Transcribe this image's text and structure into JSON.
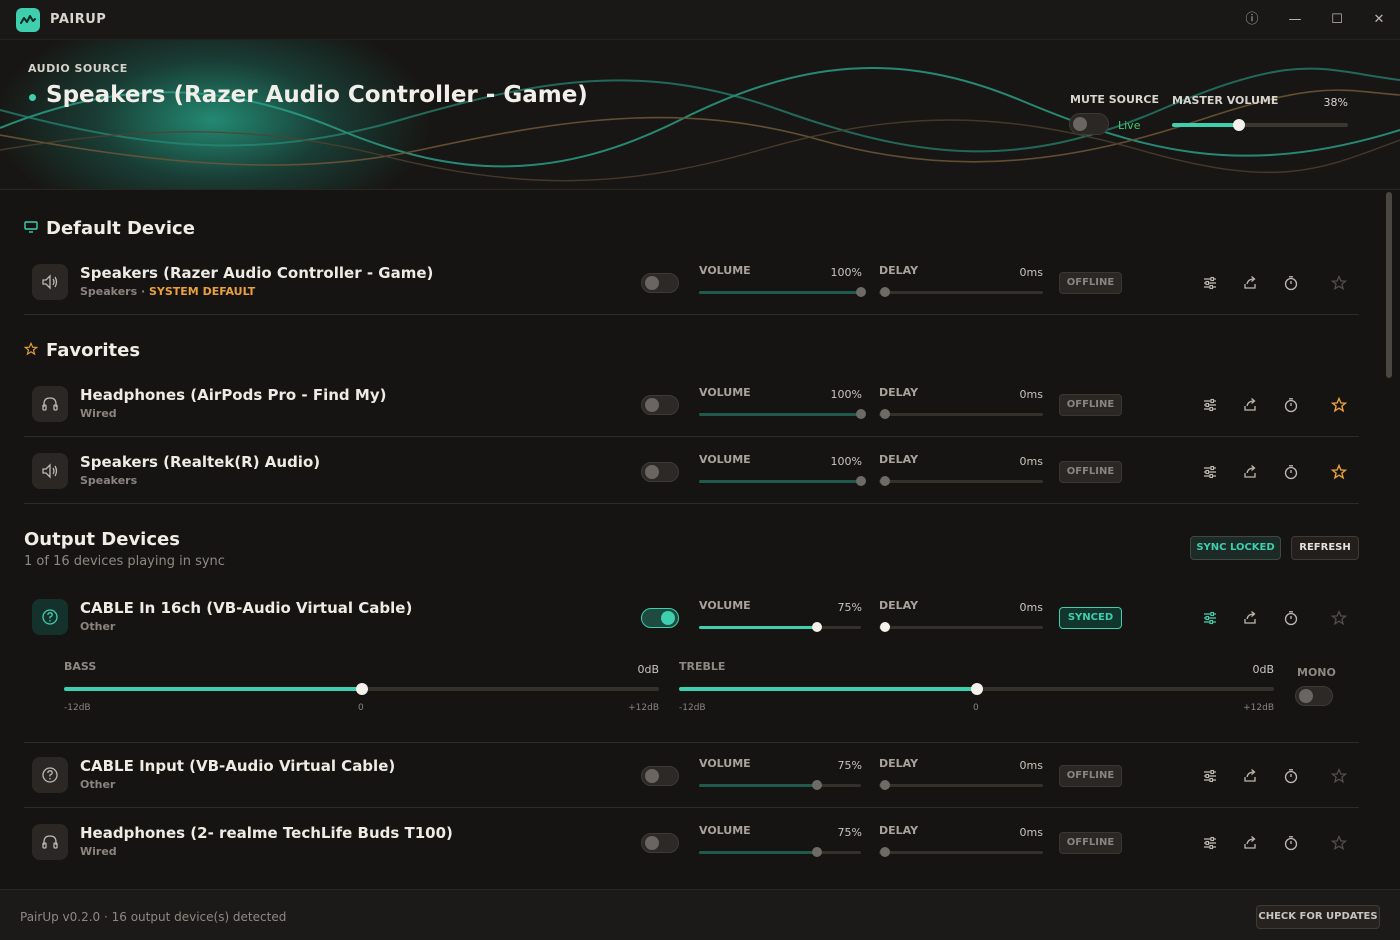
{
  "titlebar": {
    "app_name": "PAIRUP",
    "info_icon": "ⓘ",
    "minimize_icon": "—",
    "maximize_icon": "☐",
    "close_icon": "✕"
  },
  "source": {
    "label": "AUDIO SOURCE",
    "name": "Speakers (Razer Audio Controller - Game)",
    "mute_label": "MUTE SOURCE",
    "mute_on": false,
    "live_text": "Live",
    "master_label": "MASTER VOLUME",
    "master_value": "38%",
    "master_fraction": 0.38
  },
  "sections": {
    "default": "Default Device",
    "favorites": "Favorites",
    "outputs": "Output Devices",
    "outputs_sub": "1 of 16 devices playing in sync"
  },
  "labels": {
    "volume": "VOLUME",
    "delay": "DELAY",
    "bass": "BASS",
    "treble": "TREBLE",
    "mono": "MONO"
  },
  "buttons": {
    "sync_locked": "SYNC LOCKED",
    "refresh": "REFRESH",
    "check_updates": "CHECK FOR UPDATES"
  },
  "default_device": {
    "name": "Speakers (Razer Audio Controller - Game)",
    "type": "Speakers",
    "badge": "SYSTEM DEFAULT",
    "enabled": false,
    "volume": "100%",
    "volume_fraction": 1.0,
    "delay": "0ms",
    "status": "OFFLINE",
    "favorite": false
  },
  "favorites": [
    {
      "name": "Headphones (AirPods Pro - Find My)",
      "type": "Wired",
      "enabled": false,
      "volume": "100%",
      "volume_fraction": 1.0,
      "delay": "0ms",
      "status": "OFFLINE",
      "favorite": true
    },
    {
      "name": "Speakers (Realtek(R) Audio)",
      "type": "Speakers",
      "enabled": false,
      "volume": "100%",
      "volume_fraction": 1.0,
      "delay": "0ms",
      "status": "OFFLINE",
      "favorite": true
    }
  ],
  "outputs": [
    {
      "name": "CABLE In 16ch (VB-Audio Virtual Cable)",
      "type": "Other",
      "enabled": true,
      "volume": "75%",
      "volume_fraction": 0.75,
      "delay": "0ms",
      "status": "SYNCED",
      "favorite": false
    },
    {
      "name": "CABLE Input (VB-Audio Virtual Cable)",
      "type": "Other",
      "enabled": false,
      "volume": "75%",
      "volume_fraction": 0.75,
      "delay": "0ms",
      "status": "OFFLINE",
      "favorite": false
    },
    {
      "name": "Headphones (2- realme TechLife Buds T100)",
      "type": "Wired",
      "enabled": false,
      "volume": "75%",
      "volume_fraction": 0.75,
      "delay": "0ms",
      "status": "OFFLINE",
      "favorite": false
    }
  ],
  "eq": {
    "bass_value": "0dB",
    "bass_fraction": 0.5,
    "treble_value": "0dB",
    "treble_fraction": 0.5,
    "min_tick": "-12dB",
    "mid_tick": "0",
    "max_tick": "+12dB",
    "mono_on": false
  },
  "footer": {
    "text": "PairUp v0.2.0 · 16 output device(s) detected"
  },
  "colors": {
    "accent": "#3ecfae",
    "warning": "#e8a13c",
    "live": "#3ecf6e"
  }
}
